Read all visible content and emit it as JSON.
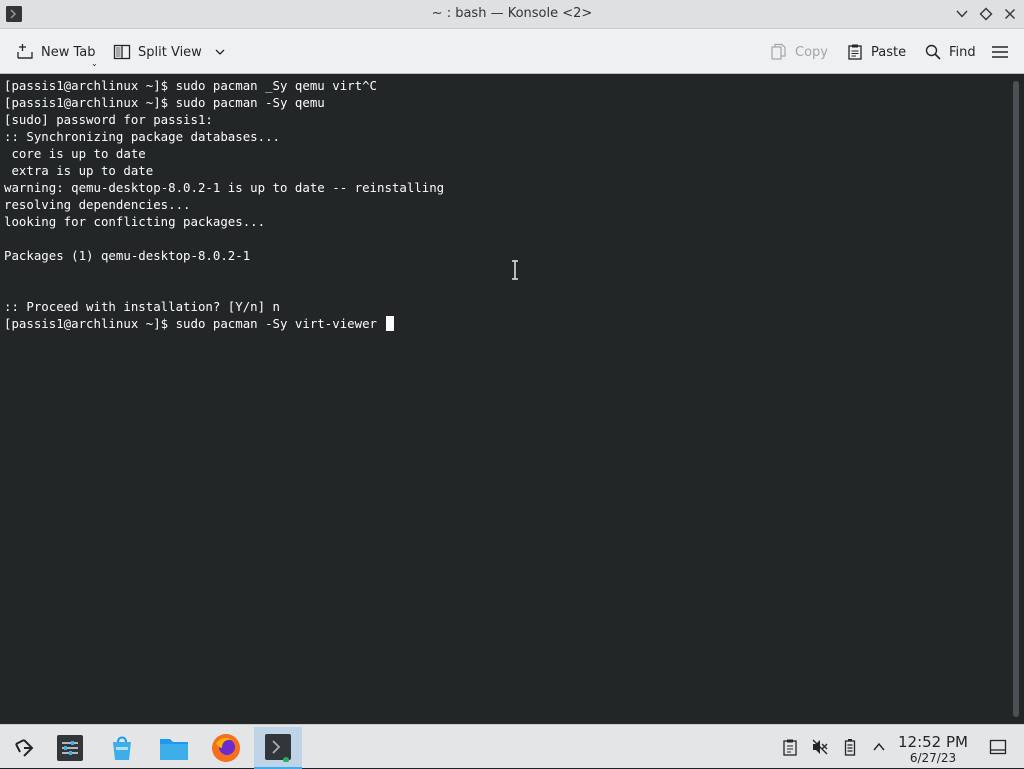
{
  "window": {
    "title": "~ : bash — Konsole <2>"
  },
  "toolbar": {
    "new_tab": "New Tab",
    "split_view": "Split View",
    "copy": "Copy",
    "paste": "Paste",
    "find": "Find"
  },
  "terminal": {
    "lines": [
      "[passis1@archlinux ~]$ sudo pacman _Sy qemu virt^C",
      "[passis1@archlinux ~]$ sudo pacman -Sy qemu",
      "[sudo] password for passis1:",
      ":: Synchronizing package databases...",
      " core is up to date",
      " extra is up to date",
      "warning: qemu-desktop-8.0.2-1 is up to date -- reinstalling",
      "resolving dependencies...",
      "looking for conflicting packages...",
      "",
      "Packages (1) qemu-desktop-8.0.2-1",
      "",
      "",
      ":: Proceed with installation? [Y/n] n",
      "[passis1@archlinux ~]$ sudo pacman -Sy virt-viewer "
    ]
  },
  "taskbar": {
    "clock_time": "12:52 PM",
    "clock_date": "6/27/23",
    "icons": [
      "app-launcher-icon",
      "system-settings-icon",
      "discover-icon",
      "file-manager-icon",
      "firefox-icon",
      "konsole-icon"
    ],
    "tray_icons": [
      "clipboard-icon",
      "volume-muted-icon",
      "battery-icon",
      "tray-expand-icon",
      "show-desktop-icon"
    ]
  },
  "colors": {
    "terminal_bg": "#232627",
    "terminal_fg": "#fcfcfc",
    "accent": "#3daee9"
  }
}
